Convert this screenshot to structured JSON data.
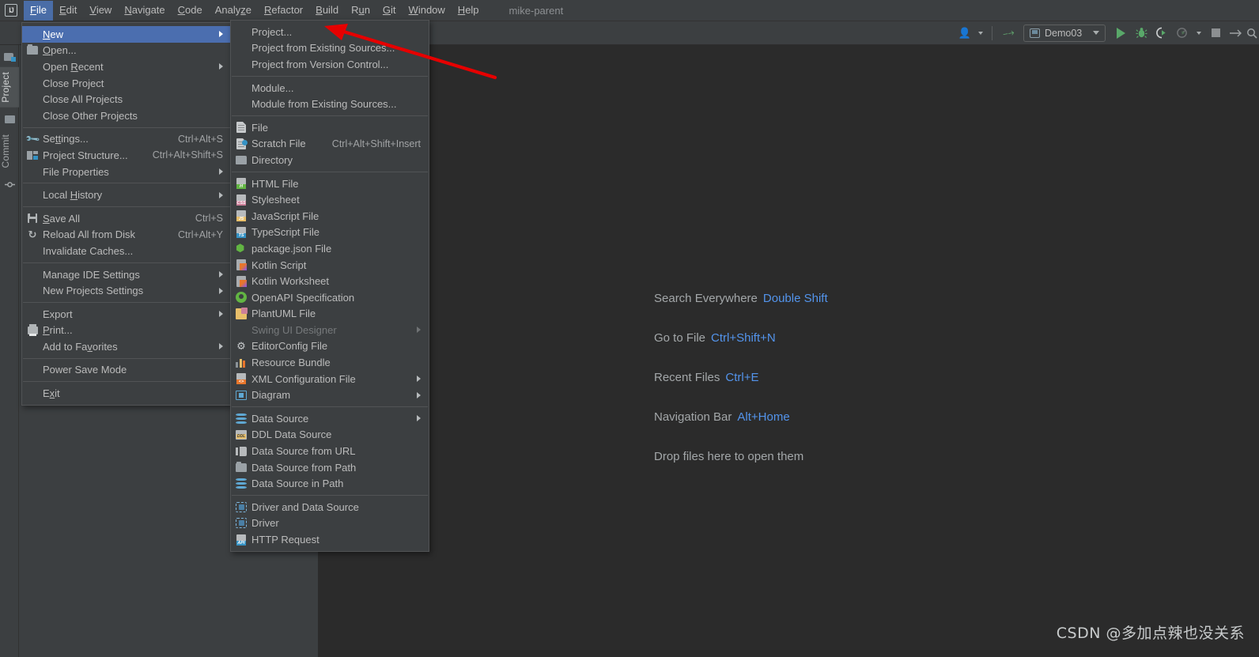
{
  "window": {
    "app_logo": "IJ",
    "project_name": "mike-parent"
  },
  "menubar": {
    "items": [
      {
        "label": "File",
        "mnemonic": "F",
        "active": true
      },
      {
        "label": "Edit",
        "mnemonic": "E",
        "active": false
      },
      {
        "label": "View",
        "mnemonic": "V",
        "active": false
      },
      {
        "label": "Navigate",
        "mnemonic": "N",
        "active": false
      },
      {
        "label": "Code",
        "mnemonic": "C",
        "active": false
      },
      {
        "label": "Analyze",
        "mnemonic": "z",
        "active": false
      },
      {
        "label": "Refactor",
        "mnemonic": "R",
        "active": false
      },
      {
        "label": "Build",
        "mnemonic": "B",
        "active": false
      },
      {
        "label": "Run",
        "mnemonic": "u",
        "active": false
      },
      {
        "label": "Git",
        "mnemonic": "G",
        "active": false
      },
      {
        "label": "Window",
        "mnemonic": "W",
        "active": false
      },
      {
        "label": "Help",
        "mnemonic": "H",
        "active": false
      }
    ]
  },
  "toolbar": {
    "run_config": "Demo03",
    "buttons": [
      "user-avatar-icon",
      "build-hammer-icon",
      "run-config-selector",
      "run-icon",
      "debug-icon",
      "run-with-coverage-icon",
      "profile-icon",
      "stop-icon",
      "next-icon"
    ]
  },
  "toolstrip": {
    "tabs": [
      "Project",
      "Commit"
    ]
  },
  "file_menu": {
    "title": "File",
    "groups": [
      [
        {
          "label": "New",
          "mnemonic": "N",
          "icon": null,
          "shortcut": "",
          "submenu": true,
          "highlighted": true
        },
        {
          "label": "Open...",
          "mnemonic": "O",
          "icon": "folder-open-icon",
          "shortcut": "",
          "submenu": false
        },
        {
          "label": "Open Recent",
          "mnemonic": "R",
          "icon": null,
          "shortcut": "",
          "submenu": true
        },
        {
          "label": "Close Project",
          "icon": null,
          "shortcut": "",
          "submenu": false
        },
        {
          "label": "Close All Projects",
          "icon": null,
          "shortcut": "",
          "submenu": false
        },
        {
          "label": "Close Other Projects",
          "icon": null,
          "shortcut": "",
          "submenu": false
        }
      ],
      [
        {
          "label": "Settings...",
          "mnemonic": "tt",
          "icon": "wrench-icon",
          "shortcut": "Ctrl+Alt+S",
          "submenu": false
        },
        {
          "label": "Project Structure...",
          "icon": "project-structure-icon",
          "shortcut": "Ctrl+Alt+Shift+S",
          "submenu": false
        },
        {
          "label": "File Properties",
          "icon": null,
          "shortcut": "",
          "submenu": true
        }
      ],
      [
        {
          "label": "Local History",
          "mnemonic": "H",
          "icon": null,
          "shortcut": "",
          "submenu": true
        }
      ],
      [
        {
          "label": "Save All",
          "mnemonic": "S",
          "icon": "save-icon",
          "shortcut": "Ctrl+S",
          "submenu": false
        },
        {
          "label": "Reload All from Disk",
          "icon": "reload-icon",
          "shortcut": "Ctrl+Alt+Y",
          "submenu": false
        },
        {
          "label": "Invalidate Caches...",
          "icon": null,
          "shortcut": "",
          "submenu": false
        }
      ],
      [
        {
          "label": "Manage IDE Settings",
          "icon": null,
          "shortcut": "",
          "submenu": true
        },
        {
          "label": "New Projects Settings",
          "icon": null,
          "shortcut": "",
          "submenu": true
        }
      ],
      [
        {
          "label": "Export",
          "icon": null,
          "shortcut": "",
          "submenu": true
        },
        {
          "label": "Print...",
          "mnemonic": "P",
          "icon": "print-icon",
          "shortcut": "",
          "submenu": false
        },
        {
          "label": "Add to Favorites",
          "mnemonic": "v",
          "icon": null,
          "shortcut": "",
          "submenu": true
        }
      ],
      [
        {
          "label": "Power Save Mode",
          "icon": null,
          "shortcut": "",
          "submenu": false
        }
      ],
      [
        {
          "label": "Exit",
          "mnemonic": "x",
          "icon": null,
          "shortcut": "",
          "submenu": false
        }
      ]
    ]
  },
  "new_menu": {
    "title": "New",
    "groups": [
      [
        {
          "label": "Project...",
          "icon": null,
          "shortcut": "",
          "submenu": false
        },
        {
          "label": "Project from Existing Sources...",
          "icon": null,
          "shortcut": "",
          "submenu": false
        },
        {
          "label": "Project from Version Control...",
          "icon": null,
          "shortcut": "",
          "submenu": false
        }
      ],
      [
        {
          "label": "Module...",
          "icon": null,
          "shortcut": "",
          "submenu": false
        },
        {
          "label": "Module from Existing Sources...",
          "icon": null,
          "shortcut": "",
          "submenu": false
        }
      ],
      [
        {
          "label": "File",
          "icon": "file-icon",
          "shortcut": "",
          "submenu": false
        },
        {
          "label": "Scratch File",
          "icon": "scratch-file-icon",
          "shortcut": "Ctrl+Alt+Shift+Insert",
          "submenu": false
        },
        {
          "label": "Directory",
          "icon": "directory-icon",
          "shortcut": "",
          "submenu": false
        }
      ],
      [
        {
          "label": "HTML File",
          "icon": "html-file-icon",
          "shortcut": "",
          "submenu": false
        },
        {
          "label": "Stylesheet",
          "icon": "css-file-icon",
          "shortcut": "",
          "submenu": false
        },
        {
          "label": "JavaScript File",
          "icon": "js-file-icon",
          "shortcut": "",
          "submenu": false
        },
        {
          "label": "TypeScript File",
          "icon": "ts-file-icon",
          "shortcut": "",
          "submenu": false
        },
        {
          "label": "package.json File",
          "icon": "packagejson-icon",
          "shortcut": "",
          "submenu": false
        },
        {
          "label": "Kotlin Script",
          "icon": "kotlin-icon",
          "shortcut": "",
          "submenu": false
        },
        {
          "label": "Kotlin Worksheet",
          "icon": "kotlin-icon",
          "shortcut": "",
          "submenu": false
        },
        {
          "label": "OpenAPI Specification",
          "icon": "openapi-icon",
          "shortcut": "",
          "submenu": false
        },
        {
          "label": "PlantUML File",
          "icon": "plantuml-icon",
          "shortcut": "",
          "submenu": false
        },
        {
          "label": "Swing UI Designer",
          "icon": null,
          "shortcut": "",
          "submenu": true,
          "disabled": true
        },
        {
          "label": "EditorConfig File",
          "icon": "gear-icon",
          "shortcut": "",
          "submenu": false
        },
        {
          "label": "Resource Bundle",
          "icon": "resource-bundle-icon",
          "shortcut": "",
          "submenu": false
        },
        {
          "label": "XML Configuration File",
          "icon": "xml-file-icon",
          "shortcut": "",
          "submenu": true
        },
        {
          "label": "Diagram",
          "icon": "diagram-icon",
          "shortcut": "",
          "submenu": true
        }
      ],
      [
        {
          "label": "Data Source",
          "icon": "database-icon",
          "shortcut": "",
          "submenu": true
        },
        {
          "label": "DDL Data Source",
          "icon": "ddl-icon",
          "shortcut": "",
          "submenu": false
        },
        {
          "label": "Data Source from URL",
          "icon": "url-icon",
          "shortcut": "",
          "submenu": false
        },
        {
          "label": "Data Source from Path",
          "icon": "folder-open-icon",
          "shortcut": "",
          "submenu": false
        },
        {
          "label": "Data Source in Path",
          "icon": "database-icon",
          "shortcut": "",
          "submenu": false
        }
      ],
      [
        {
          "label": "Driver and Data Source",
          "icon": "driver-icon",
          "shortcut": "",
          "submenu": false
        },
        {
          "label": "Driver",
          "icon": "driver-icon",
          "shortcut": "",
          "submenu": false
        },
        {
          "label": "HTTP Request",
          "icon": "http-request-icon",
          "shortcut": "",
          "submenu": false
        }
      ]
    ]
  },
  "editor_hints": [
    {
      "label": "Search Everywhere",
      "key": "Double Shift"
    },
    {
      "label": "Go to File",
      "key": "Ctrl+Shift+N"
    },
    {
      "label": "Recent Files",
      "key": "Ctrl+E"
    },
    {
      "label": "Navigation Bar",
      "key": "Alt+Home"
    },
    {
      "label": "Drop files here to open them",
      "key": ""
    }
  ],
  "watermark": "CSDN @多加点辣也没关系",
  "colors": {
    "background": "#2b2b2b",
    "panel": "#3c3f41",
    "highlight": "#4b6eaf",
    "menubar_highlight": "#4a6da7",
    "text": "#bbbbbb",
    "link": "#5394ec",
    "accent_green": "#59a869",
    "annotation_red": "#e60000"
  }
}
